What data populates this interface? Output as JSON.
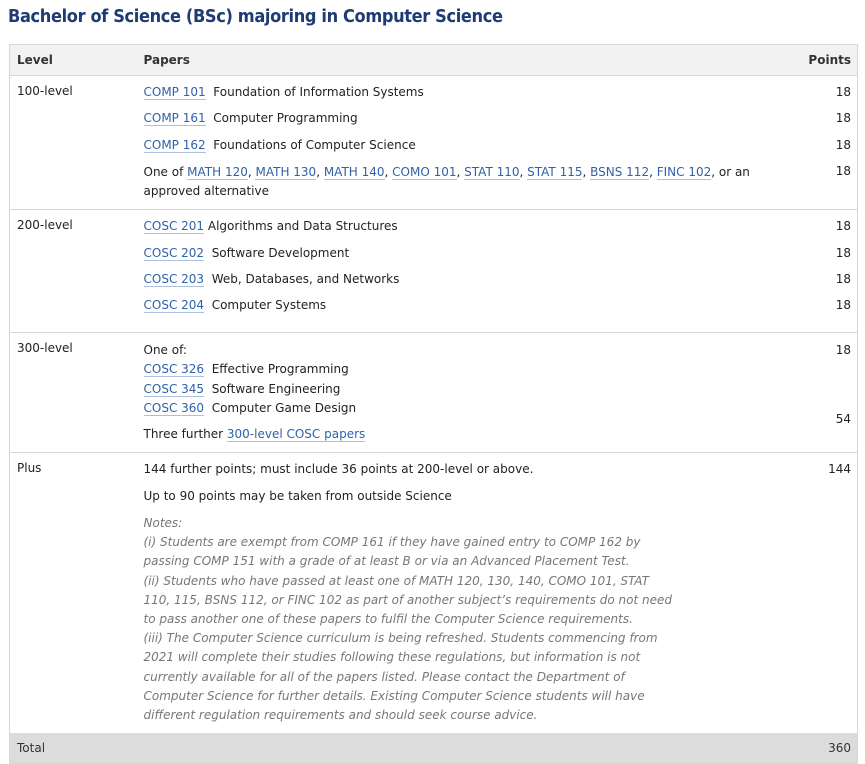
{
  "title": "Bachelor of Science (BSc) majoring in Computer Science",
  "headers": {
    "level": "Level",
    "papers": "Papers",
    "points": "Points"
  },
  "rows": {
    "l100": {
      "level": "100-level",
      "items": [
        {
          "code": "COMP 101",
          "name": "Foundation of Information Systems",
          "points": "18"
        },
        {
          "code": "COMP 161",
          "name": "Computer Programming",
          "points": "18"
        },
        {
          "code": "COMP 162",
          "name": "Foundations of Computer Science",
          "points": "18"
        }
      ],
      "oneof": {
        "prefix": "One of ",
        "codes": [
          "MATH 120",
          "MATH 130",
          "MATH 140",
          "COMO 101",
          "STAT 110",
          "STAT 115",
          "BSNS 112",
          "FINC 102"
        ],
        "suffix": ", or an approved alternative",
        "points": "18"
      }
    },
    "l200": {
      "level": "200-level",
      "items": [
        {
          "code": "COSC 201",
          "name": "Algorithms and Data Structures",
          "points": "18"
        },
        {
          "code": "COSC 202",
          "name": "Software Development",
          "points": "18"
        },
        {
          "code": "COSC 203",
          "name": "Web, Databases, and Networks",
          "points": "18"
        },
        {
          "code": "COSC 204",
          "name": "Computer Systems",
          "points": "18"
        }
      ]
    },
    "l300": {
      "level": "300-level",
      "oneof_label": "One of:",
      "items": [
        {
          "code": "COSC 326",
          "name": "Effective Programming"
        },
        {
          "code": "COSC 345",
          "name": "Software Engineering"
        },
        {
          "code": "COSC 360",
          "name": "Computer Game Design"
        }
      ],
      "points_oneof": "18",
      "further_prefix": "Three further ",
      "further_link": "300-level COSC papers",
      "points_further": "54"
    },
    "plus": {
      "level": "Plus",
      "line1": "144 further points; must include 36 points at 200-level or above.",
      "line2": "Up to 90 points may be taken from outside Science",
      "points": "144",
      "notes": [
        "Notes:",
        "(i) Students are exempt from COMP 161 if they have gained entry to COMP 162 by passing COMP 151 with a grade of at least B or via an Advanced Placement Test.",
        "(ii) Students who have passed at least one of MATH 120, 130, 140, COMO 101, STAT 110, 115, BSNS 112, or FINC 102 as part of another subject’s requirements do not need to pass another one of these papers to fulfil the Computer Science requirements.",
        "(iii) The Computer Science curriculum is being refreshed. Students commencing from 2021 will complete their studies following these regulations, but information is not currently available for all of the papers listed. Please contact the Department of Computer Science for further details. Existing Computer Science students will have different regulation requirements and should seek course advice."
      ]
    }
  },
  "total": {
    "label": "Total",
    "points": "360"
  },
  "colors": {
    "title": "#1f3b73",
    "link": "#2f62a8",
    "header_bg": "#f2f2f2",
    "footer_bg": "#dcdcdc",
    "notes": "#777777"
  }
}
